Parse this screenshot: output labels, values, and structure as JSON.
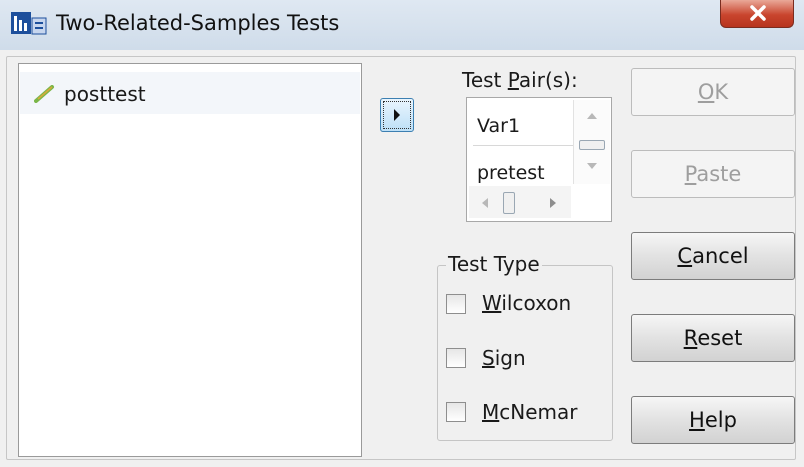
{
  "window": {
    "title": "Two-Related-Samples Tests",
    "close_label": "✕",
    "icon": "spss-dialog-icon"
  },
  "variables": {
    "items": [
      {
        "label": "posttest",
        "icon": "scale-variable-icon"
      }
    ]
  },
  "move_button": {
    "icon": "right-arrow-icon"
  },
  "test_pairs": {
    "label_before": "Test ",
    "label_accel": "P",
    "label_after": "air(s):",
    "var1_header": "Var1",
    "row_value": "pretest"
  },
  "test_type": {
    "title": "Test Type",
    "options": [
      {
        "accel": "W",
        "rest": "ilcoxon",
        "checked": false
      },
      {
        "accel": "S",
        "rest": "ign",
        "checked": false
      },
      {
        "accel": "M",
        "rest": "cNemar",
        "checked": false
      }
    ]
  },
  "buttons": {
    "ok": {
      "accel": "O",
      "rest": "K",
      "enabled": false
    },
    "paste": {
      "accel": "P",
      "rest": "aste",
      "enabled": false
    },
    "cancel": {
      "accel": "C",
      "rest": "ancel",
      "enabled": true
    },
    "reset": {
      "accel": "R",
      "rest": "eset",
      "enabled": true
    },
    "help": {
      "accel": "H",
      "rest": "elp",
      "enabled": true
    }
  }
}
